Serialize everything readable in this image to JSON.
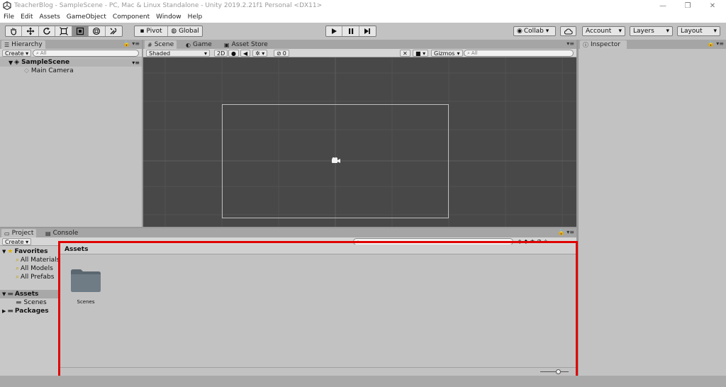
{
  "titlebar": {
    "title": "TeacherBlog - SampleScene - PC, Mac & Linux Standalone - Unity 2019.2.21f1 Personal <DX11>",
    "minimize": "—",
    "maximize": "❐",
    "close": "✕"
  },
  "menubar": {
    "items": [
      "File",
      "Edit",
      "Assets",
      "GameObject",
      "Component",
      "Window",
      "Help"
    ]
  },
  "toolbar": {
    "pivot_label": "Pivot",
    "global_label": "Global",
    "collab_label": "Collab ▾",
    "account_label": "Account",
    "layers_label": "Layers",
    "layout_label": "Layout"
  },
  "hierarchy": {
    "tab_label": "Hierarchy",
    "create_label": "Create ▾",
    "search_placeholder": "All",
    "scene_name": "SampleScene",
    "items": [
      "Main Camera"
    ]
  },
  "scene": {
    "tabs": [
      "Scene",
      "Game",
      "Asset Store"
    ],
    "shading_mode": "Shaded",
    "mode_2d": "2D",
    "effects_count": "0",
    "gizmos_label": "Gizmos",
    "search_placeholder": "All"
  },
  "inspector": {
    "tab_label": "Inspector"
  },
  "project": {
    "tabs": [
      "Project",
      "Console"
    ],
    "create_label": "Create ▾",
    "favorites_label": "Favorites",
    "favorites": [
      "All Materials",
      "All Models",
      "All Prefabs"
    ],
    "assets_label": "Assets",
    "assets_children": [
      "Scenes"
    ],
    "packages_label": "Packages",
    "breadcrumb": "Assets",
    "grid_items": [
      {
        "name": "Scenes"
      }
    ]
  },
  "colors": {
    "highlight_border": "#e00000",
    "scene_bg": "#484848",
    "panel_bg": "#c2c2c2"
  }
}
